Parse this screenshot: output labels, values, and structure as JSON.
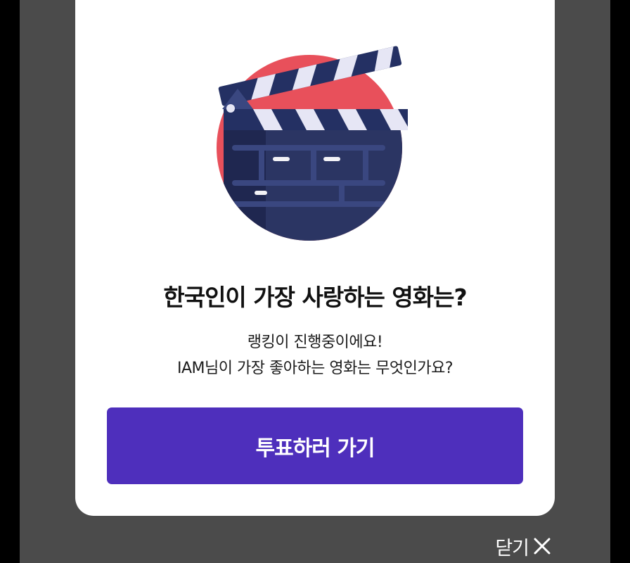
{
  "modal": {
    "illustration": "clapperboard-icon",
    "title": "한국인이 가장 사랑하는 영화는?",
    "description_line1": "랭킹이 진행중이에요!",
    "description_line2": "IAM님이 가장 좋아하는 영화는 무엇인가요?",
    "cta_label": "투표하러 가기"
  },
  "close": {
    "label": "닫기",
    "icon": "close-icon"
  },
  "colors": {
    "overlay": "#4b4b4b",
    "accent": "#4e2fbc",
    "illustration_circle": "#e8505b",
    "clapper_body": "#2b3563"
  }
}
